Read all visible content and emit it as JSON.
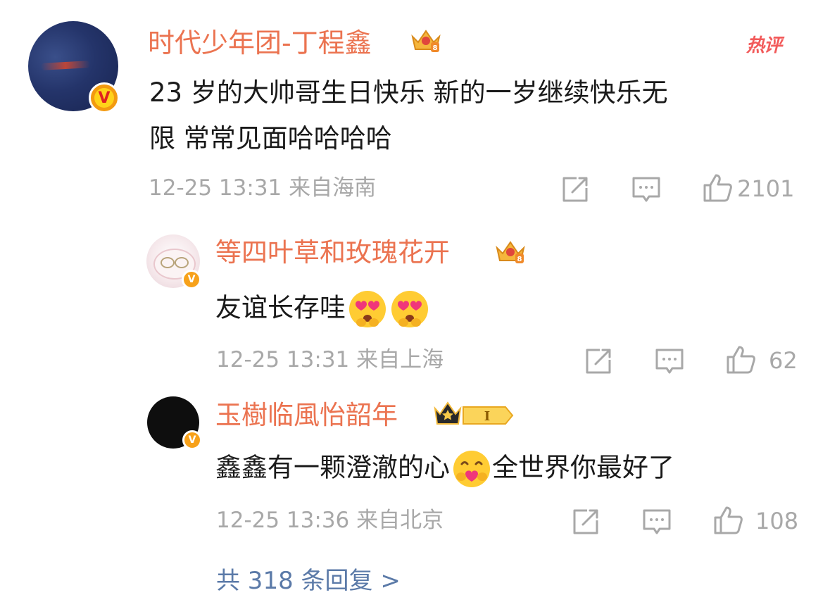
{
  "comment": {
    "author": "时代少年团-丁程鑫",
    "verified_badge": "V",
    "hot_label": "热评",
    "text_line1": "23 岁的大帅哥生日快乐 新的一岁继续快乐无",
    "text_line2": "限 常常见面哈哈哈哈",
    "time": "12-25 13:31",
    "location": "来自海南",
    "likes": "2101"
  },
  "replies": [
    {
      "author": "等四叶草和玫瑰花开",
      "verified_badge": "V",
      "text": "友谊长存哇",
      "emojis": [
        "heart-eyes-emoji",
        "heart-eyes-emoji"
      ],
      "time": "12-25 13:31",
      "location": "来自上海",
      "likes": "62"
    },
    {
      "author": "玉樹临風怡韶年",
      "verified_badge": "V",
      "text_before": "鑫鑫有一颗澄澈的心",
      "emoji": "hug-heart-emoji",
      "text_after": "全世界你最好了",
      "level_badge": "I",
      "time": "12-25 13:36",
      "location": "来自北京",
      "likes": "108"
    }
  ],
  "more_replies": "共 318 条回复 >",
  "colors": {
    "name": "#eb7350",
    "meta": "#a8a8a8",
    "link": "#5b7aa8",
    "hot": "#f25a5a",
    "badge": "#f7a11a"
  }
}
